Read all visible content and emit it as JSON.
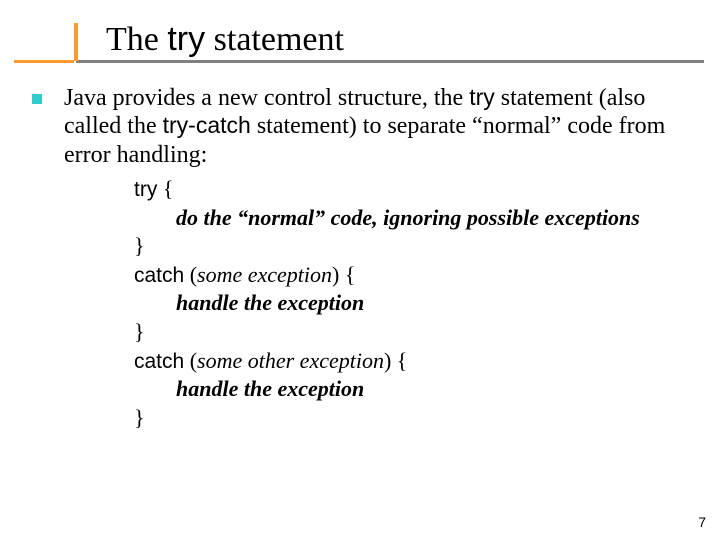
{
  "title": {
    "t1": "The ",
    "kw": "try",
    "t2": " statement"
  },
  "para": {
    "p1": "Java provides a new control structure, the ",
    "kw1": "try",
    "p2": " statement (also called the ",
    "kw2": "try-catch",
    "p3": " statement) to separate “normal” code from error handling:"
  },
  "code": {
    "l1_kw": "try",
    "l1_rest": " {",
    "l2": "do the “normal” code, ignoring possible exceptions",
    "l3": "}",
    "l4_kw": "catch",
    "l4_open": " (",
    "l4_arg": "some exception",
    "l4_close": ") {",
    "l5": "handle the exception",
    "l6": "}",
    "l7_kw": "catch",
    "l7_open": " (",
    "l7_arg": "some other exception",
    "l7_close": ") {",
    "l8": "handle the exception",
    "l9": "}"
  },
  "page": "7"
}
